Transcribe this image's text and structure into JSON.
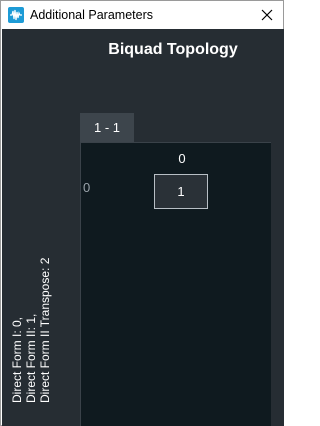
{
  "window": {
    "title": "Additional Parameters",
    "app_icon": "waveform-app-icon",
    "close_icon": "close-icon"
  },
  "panel": {
    "title": "Biquad Topology",
    "description_lines": [
      "Direct Form I: 0,",
      "Direct Form II: 1,",
      "Direct Form II Transpose: 2"
    ]
  },
  "matrix": {
    "tab_label": "1 - 1",
    "column_header": "0",
    "row_header": "0",
    "cell_value": "1"
  },
  "colors": {
    "panel_background": "#262d33",
    "grid_background": "#0f1a1f",
    "tab_background": "#3d454c",
    "app_icon_blue": "#1d9bd6"
  }
}
